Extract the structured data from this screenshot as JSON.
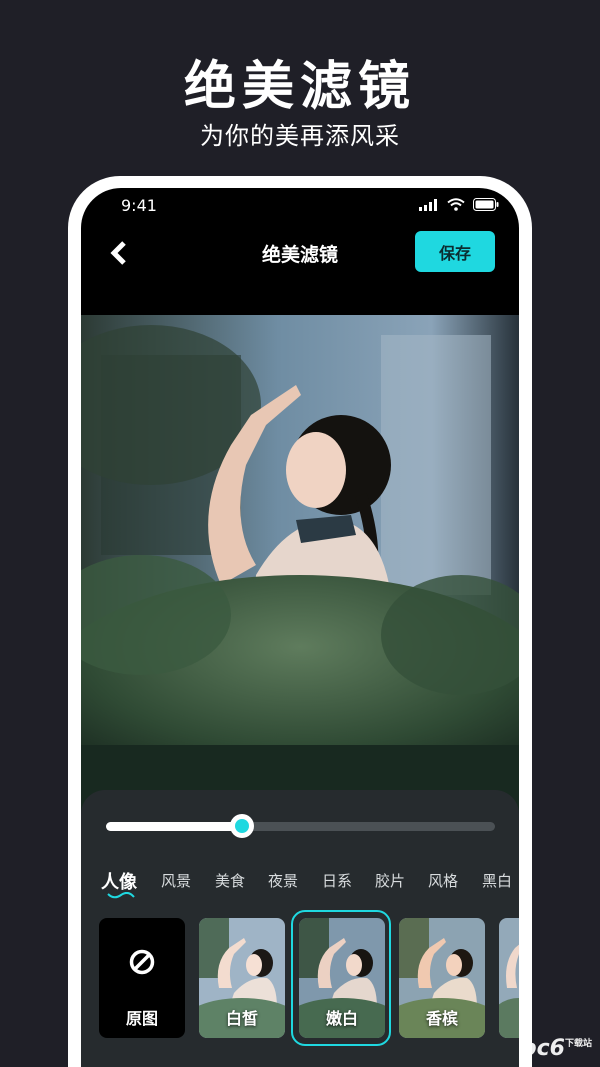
{
  "hero": {
    "title": "绝美滤镜",
    "subtitle": "为你的美再添风采"
  },
  "status_bar": {
    "time": "9:41"
  },
  "nav": {
    "back_icon": "chevron-left-icon",
    "title": "绝美滤镜",
    "save_label": "保存"
  },
  "slider": {
    "value": 0.35
  },
  "categories": [
    "人像",
    "风景",
    "美食",
    "夜景",
    "日系",
    "胶片",
    "风格",
    "黑白"
  ],
  "active_category": "人像",
  "filters": [
    {
      "label": "原图",
      "icon": "no-filter-icon"
    },
    {
      "label": "白皙"
    },
    {
      "label": "嫩白",
      "selected": true
    },
    {
      "label": "香槟"
    }
  ],
  "colors": {
    "accent": "#1fd8e0",
    "background": "#1f1f27",
    "panel": "#262b2e"
  },
  "watermark": {
    "text": "pc6",
    "sub": "下载站"
  }
}
